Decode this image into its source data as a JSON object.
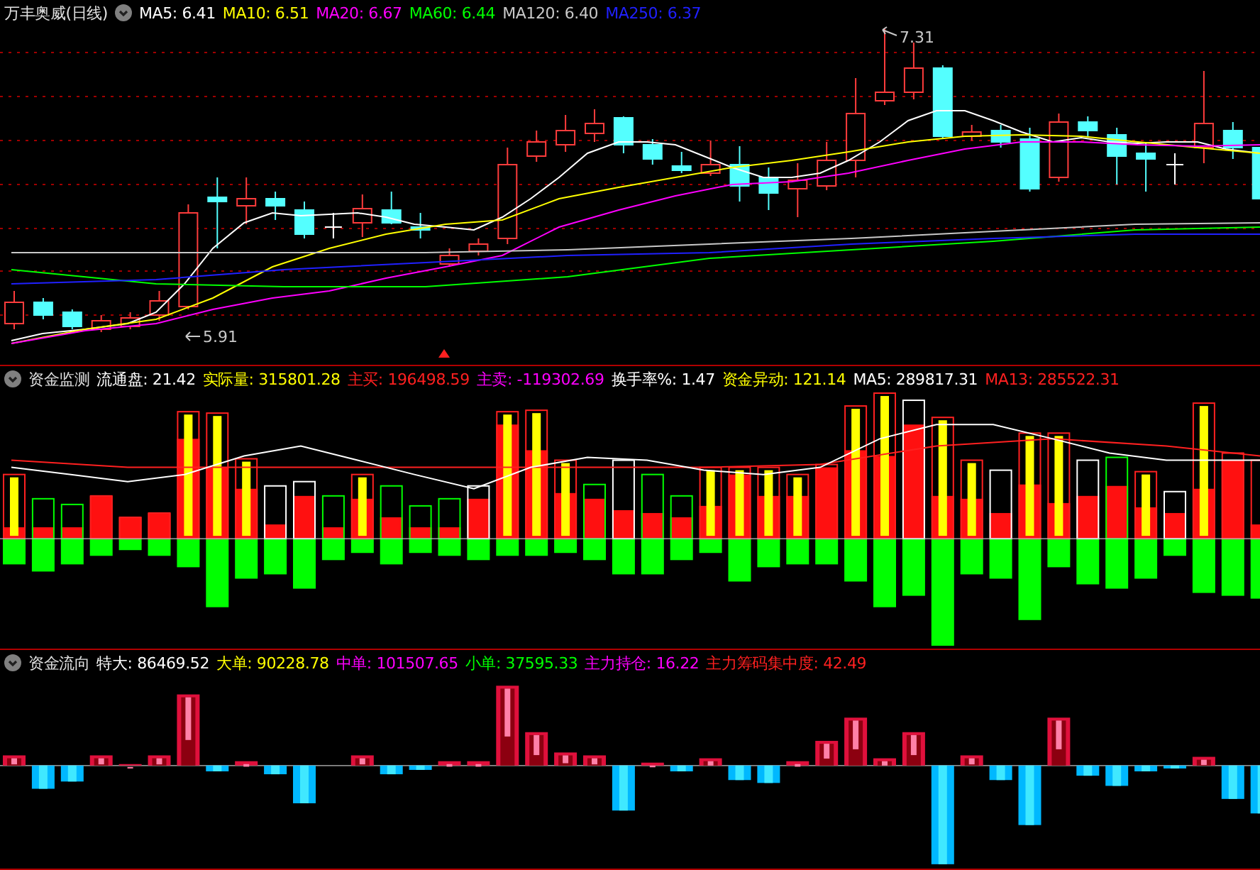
{
  "panels": [
    {
      "kind": "price",
      "title": "万丰奥威(日线)",
      "high_label": "7.31",
      "low_label": "5.91",
      "indicators": [
        {
          "text": "MA5: 6.41",
          "color": "#ffffff"
        },
        {
          "text": "MA10: 6.51",
          "color": "#ffff00"
        },
        {
          "text": "MA20: 6.67",
          "color": "#ff00ff"
        },
        {
          "text": "MA60: 6.44",
          "color": "#00ff00"
        },
        {
          "text": "MA120: 6.40",
          "color": "#c8c8c8"
        },
        {
          "text": "MA250: 6.37",
          "color": "#2020ff"
        }
      ]
    },
    {
      "kind": "fund_monitor",
      "title": "资金监测",
      "indicators": [
        {
          "text": "流通盘: 21.42",
          "color": "#ffffff"
        },
        {
          "text": "实际量: 315801.28",
          "color": "#ffff00"
        },
        {
          "text": "主买: 196498.59",
          "color": "#ff2020"
        },
        {
          "text": "主卖: -119302.69",
          "color": "#ff00ff"
        },
        {
          "text": "换手率%: 1.47",
          "color": "#ffffff"
        },
        {
          "text": "资金异动: 121.14",
          "color": "#ffff00"
        },
        {
          "text": "MA5: 289817.31",
          "color": "#ffffff"
        },
        {
          "text": "MA13: 285522.31",
          "color": "#ff2020"
        }
      ]
    },
    {
      "kind": "fund_flow",
      "title": "资金流向",
      "indicators": [
        {
          "text": "特大: 86469.52",
          "color": "#ffffff"
        },
        {
          "text": "大单: 90228.78",
          "color": "#ffff00"
        },
        {
          "text": "中单: 101507.65",
          "color": "#ff00ff"
        },
        {
          "text": "小单: 37595.33",
          "color": "#00ff00"
        },
        {
          "text": "主力持仓: 16.22",
          "color": "#ff00ff"
        },
        {
          "text": "主力筹码集中度: 42.49",
          "color": "#ff2020"
        }
      ]
    }
  ]
}
